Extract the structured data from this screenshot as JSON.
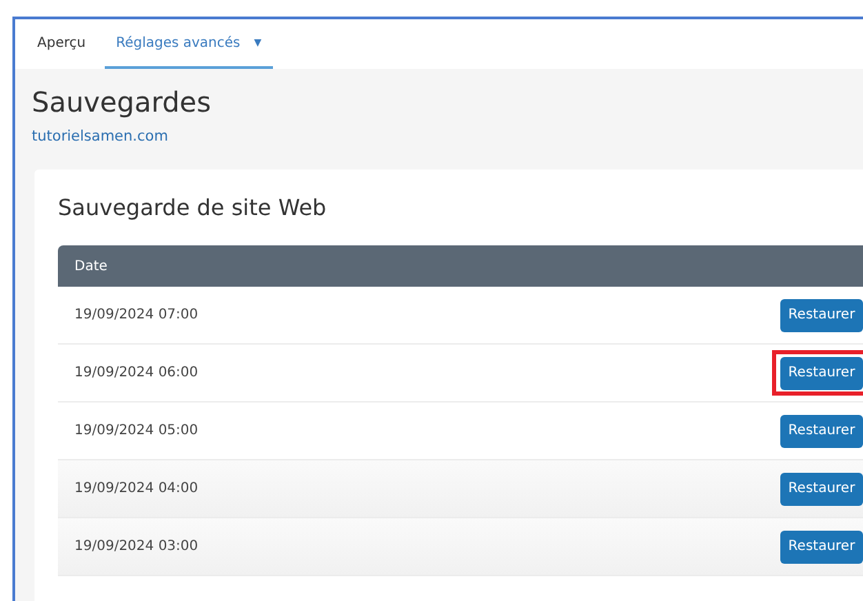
{
  "tabs": [
    {
      "label": "Aperçu",
      "selected": false
    },
    {
      "label": "Réglages avancés",
      "selected": true,
      "caret": "▼"
    }
  ],
  "page": {
    "title": "Sauvegardes",
    "link": "tutorielsamen.com"
  },
  "card": {
    "title": "Sauvegarde de site Web",
    "table": {
      "columns": [
        "Date"
      ],
      "rows": [
        {
          "date": "19/09/2024 07:00",
          "action": "Restaurer",
          "highlighted": false
        },
        {
          "date": "19/09/2024 06:00",
          "action": "Restaurer",
          "highlighted": true
        },
        {
          "date": "19/09/2024 05:00",
          "action": "Restaurer",
          "highlighted": false
        },
        {
          "date": "19/09/2024 04:00",
          "action": "Restaurer",
          "highlighted": false
        },
        {
          "date": "19/09/2024 03:00",
          "action": "Restaurer",
          "highlighted": false
        }
      ]
    }
  }
}
